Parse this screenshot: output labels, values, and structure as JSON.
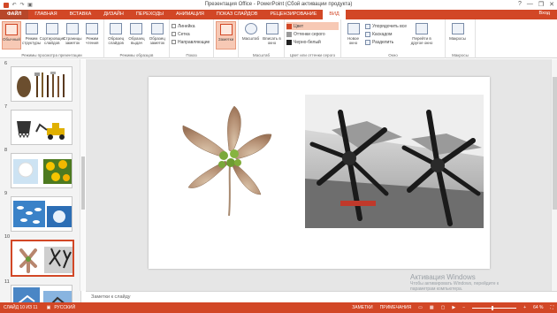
{
  "window": {
    "title": "Презентация Office - PowerPoint (Сбой активации продукта)",
    "controls": [
      "?",
      "—",
      "❐",
      "✕"
    ]
  },
  "tabs": [
    {
      "label": "ФАЙЛ",
      "kind": "file"
    },
    {
      "label": "ГЛАВНАЯ"
    },
    {
      "label": "ВСТАВКА"
    },
    {
      "label": "ДИЗАЙН"
    },
    {
      "label": "ПЕРЕХОДЫ"
    },
    {
      "label": "АНИМАЦИЯ"
    },
    {
      "label": "ПОКАЗ СЛАЙДОВ"
    },
    {
      "label": "РЕЦЕНЗИРОВАНИЕ"
    },
    {
      "label": "ВИД",
      "active": true
    }
  ],
  "user": "Вход",
  "ribbon": {
    "views_group": {
      "label": "Режимы просмотра презентации",
      "buttons": [
        "Обычный",
        "Режим структуры",
        "Сортировщик слайдов",
        "Страницы заметок",
        "Режим чтения"
      ]
    },
    "masters_group": {
      "label": "Режимы образцов",
      "buttons": [
        "Образец слайдов",
        "Образец выдач",
        "Образец заметок"
      ]
    },
    "show_group": {
      "label": "Показ",
      "items": [
        "Линейка",
        "Сетка",
        "Направляющие"
      ]
    },
    "notes_group": {
      "buttons": [
        "Заметки"
      ]
    },
    "zoom_group": {
      "label": "Масштаб",
      "buttons": [
        "Масштаб",
        "Вписать в окно"
      ]
    },
    "color_group": {
      "label": "Цвет или оттенки серого",
      "items": [
        "Цвет",
        "Оттенки серого",
        "Черно-белый"
      ]
    },
    "window_group": {
      "label": "Окно",
      "buttons": [
        "Новое окно"
      ],
      "items": [
        "Упорядочить все",
        "Каскадом",
        "Разделить"
      ],
      "switch_label": "Перейти в другое окно"
    },
    "macros_group": {
      "label": "Макросы",
      "buttons": [
        "Макросы"
      ]
    }
  },
  "slides": [
    {
      "number": "6"
    },
    {
      "number": "7"
    },
    {
      "number": "8"
    },
    {
      "number": "9"
    },
    {
      "number": "10",
      "selected": true
    },
    {
      "number": "11"
    }
  ],
  "notes_placeholder": "Заметки к слайду",
  "status": {
    "slide_info": "СЛАЙД 10 ИЗ 11",
    "language": "РУССКИЙ",
    "notes": "ЗАМЕТКИ",
    "comments": "ПРИМЕЧАНИЯ",
    "zoom": "64 %"
  },
  "watermark": {
    "line1": "Активация Windows",
    "line2": "Чтобы активировать Windows, перейдите к",
    "line3": "параметрам компьютера."
  },
  "colors": {
    "accent": "#d24726",
    "accent_dark": "#b7472a"
  }
}
